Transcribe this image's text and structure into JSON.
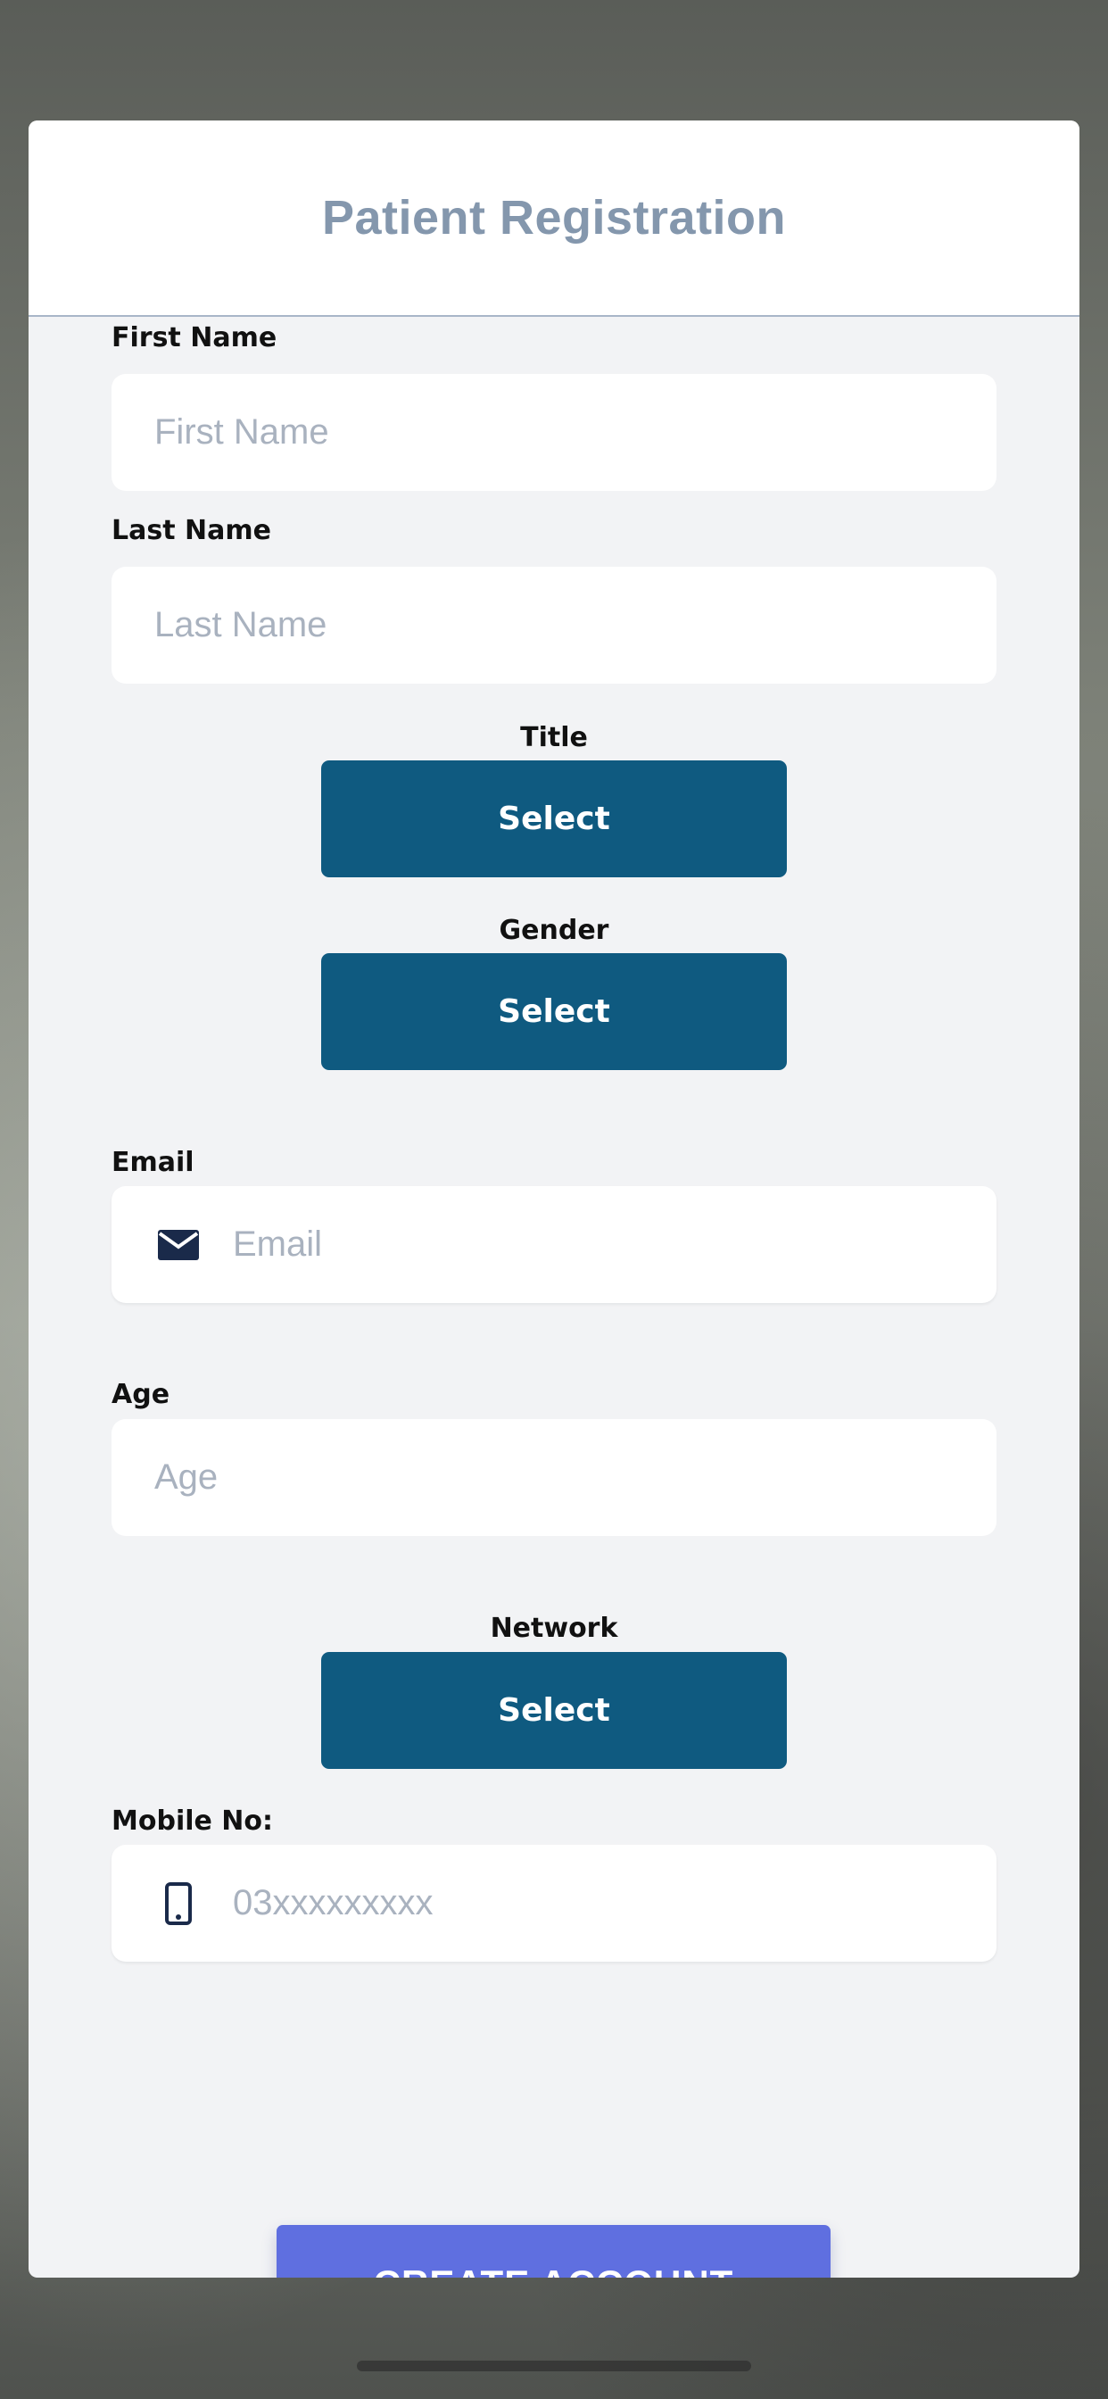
{
  "header": {
    "title": "Patient Registration"
  },
  "form": {
    "first_name": {
      "label": "First Name",
      "placeholder": "First Name"
    },
    "last_name": {
      "label": "Last Name",
      "placeholder": "Last Name"
    },
    "title": {
      "label": "Title",
      "button": "Select"
    },
    "gender": {
      "label": "Gender",
      "button": "Select"
    },
    "email": {
      "label": "Email",
      "placeholder": "Email",
      "icon": "envelope-icon"
    },
    "age": {
      "label": "Age",
      "placeholder": "Age"
    },
    "network": {
      "label": "Network",
      "button": "Select"
    },
    "mobile": {
      "label": "Mobile No:",
      "placeholder": "03xxxxxxxxx",
      "icon": "mobile-phone-icon"
    },
    "submit": "CREATE ACCOUNT"
  },
  "colors": {
    "select_button": "#0f5a80",
    "create_button": "#5f6fe0",
    "title_text": "#8497ad",
    "card_background": "#f2f3f5",
    "icon": "#1a2a4a"
  }
}
